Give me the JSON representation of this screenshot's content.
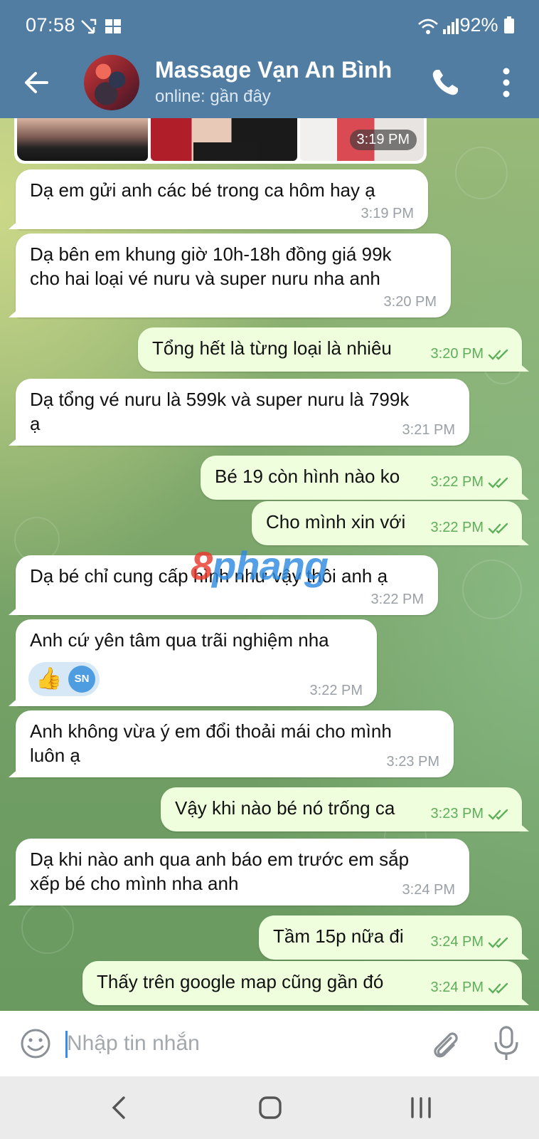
{
  "status_bar": {
    "time": "07:58",
    "battery": "92%"
  },
  "header": {
    "title": "Massage Vạn An Bình",
    "status": "online: gần đây"
  },
  "photo_message": {
    "time": "3:19 PM"
  },
  "messages": [
    {
      "text": "Dạ em gửi anh các bé trong ca hôm hay ạ",
      "time": "3:19 PM"
    },
    {
      "text": "Dạ bên em khung giờ 10h-18h đồng giá 99k\ncho hai loại vé nuru và super nuru nha anh",
      "time": "3:20 PM"
    },
    {
      "text": "Tổng hết là từng loại là nhiêu",
      "time": "3:20 PM"
    },
    {
      "text": "Dạ tổng vé nuru là 599k và super nuru là 799k\nạ",
      "time": "3:21 PM"
    },
    {
      "text": "Bé 19 còn hình nào ko",
      "time": "3:22 PM"
    },
    {
      "text": "Cho mình xin với",
      "time": "3:22 PM"
    },
    {
      "text": "Dạ bé chỉ cung cấp hình như vậy thôi anh ạ",
      "time": "3:22 PM"
    },
    {
      "text": "Anh cứ yên tâm qua trãi nghiệm nha",
      "time": "3:22 PM",
      "reaction": {
        "emoji": "👍",
        "initials": "SN"
      }
    },
    {
      "text": "Anh không vừa ý em đổi thoải mái cho mình\nluôn ạ",
      "time": "3:23 PM"
    },
    {
      "text": "Vậy khi nào bé nó trống ca",
      "time": "3:23 PM"
    },
    {
      "text": "Dạ khi nào anh qua anh báo em trước em sắp\nxếp bé cho mình nha anh",
      "time": "3:24 PM"
    },
    {
      "text": "Tầm 15p nữa đi",
      "time": "3:24 PM"
    },
    {
      "text": "Thấy trên google map cũng gần đó",
      "time": "3:24 PM"
    }
  ],
  "watermark": {
    "part1": "8",
    "part2": "phang"
  },
  "input": {
    "placeholder": "Nhập tin nhắn",
    "value": ""
  },
  "colors": {
    "header_bg": "#527da3",
    "incoming_bubble": "#ffffff",
    "outgoing_bubble": "#efffde",
    "outgoing_time": "#5fae5a",
    "read_ticks": "#5fae5a"
  },
  "icons": {
    "status": [
      "missed-call-icon",
      "gallery-icon",
      "wifi-icon",
      "signal-icon",
      "battery-icon"
    ],
    "header": [
      "back-arrow-icon",
      "phone-icon",
      "more-vertical-icon"
    ],
    "input": [
      "emoji-icon",
      "paperclip-icon",
      "microphone-icon"
    ],
    "nav": [
      "nav-back-icon",
      "nav-home-icon",
      "nav-recents-icon"
    ]
  }
}
